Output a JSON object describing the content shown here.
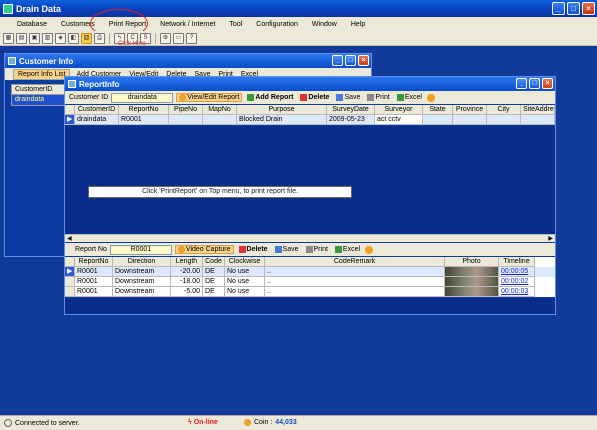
{
  "app": {
    "title": "Drain Data"
  },
  "menu": [
    "Database",
    "Customers",
    "Print Report",
    "Network / Internet",
    "Tool",
    "Configuration",
    "Window",
    "Help"
  ],
  "annotation": {
    "click_here": "Click Here",
    "note": "Click 'PrintReport' on Top menu, to print report file."
  },
  "customer_window": {
    "title": "Customer Info",
    "tabs": [
      "Report Info List",
      "Add Customer",
      "View/Edit",
      "Delete",
      "Save",
      "Print",
      "Excel"
    ],
    "column": "CustomerID",
    "row": "draindata"
  },
  "report_window": {
    "title": "ReportInfo",
    "customer_id_label": "Customer ID",
    "customer_id_value": "draindata",
    "buttons": {
      "view_edit": "View/Edit Report",
      "add": "Add Report",
      "delete": "Delete",
      "save": "Save",
      "print": "Print",
      "excel": "Excel"
    },
    "columns": [
      "CustomerID",
      "ReportNo",
      "PipeNo",
      "MapNo",
      "Purpose",
      "SurveyDate",
      "Surveyor",
      "State",
      "Province",
      "City",
      "SiteAddre"
    ],
    "rows": [
      {
        "CustomerID": "draindata",
        "ReportNo": "R0001",
        "PipeNo": "",
        "MapNo": "",
        "Purpose": "Blocked Drain",
        "SurveyDate": "2009-05-23",
        "Surveyor": "act cctv",
        "State": "",
        "Province": "",
        "City": "",
        "SiteAddre": ""
      }
    ]
  },
  "detail": {
    "report_no_label": "Report No",
    "report_no_value": "R0001",
    "buttons": {
      "video": "Video Capture",
      "delete": "Delete",
      "save": "Save",
      "print": "Print",
      "excel": "Excel"
    },
    "columns": [
      "ReportNo",
      "Direction",
      "Length",
      "Code",
      "Clockwise",
      "CodeRemark",
      "Photo",
      "Timeline"
    ],
    "rows": [
      {
        "ReportNo": "R0001",
        "Direction": "Downstream",
        "Length": "-20.00",
        "Code": "DE",
        "Clockwise": "No use",
        "CodeRemark": "..",
        "Timeline": "00:00:05"
      },
      {
        "ReportNo": "R0001",
        "Direction": "Downstream",
        "Length": "-18.00",
        "Code": "DE",
        "Clockwise": "No use",
        "CodeRemark": "..",
        "Timeline": "00:00:02"
      },
      {
        "ReportNo": "R0001",
        "Direction": "Downstream",
        "Length": "-5.00",
        "Code": "DE",
        "Clockwise": "No use",
        "CodeRemark": "..",
        "Timeline": "00:00:03"
      }
    ]
  },
  "status": {
    "connection": "Connected to server.",
    "online": "On-line",
    "coin_label": "Coin :",
    "coin_value": "44,033"
  },
  "colors": {
    "workspace": "#123a9a",
    "titlebar": "#0a4cc8",
    "highlight": "#fbd38a",
    "online": "#d22222"
  }
}
